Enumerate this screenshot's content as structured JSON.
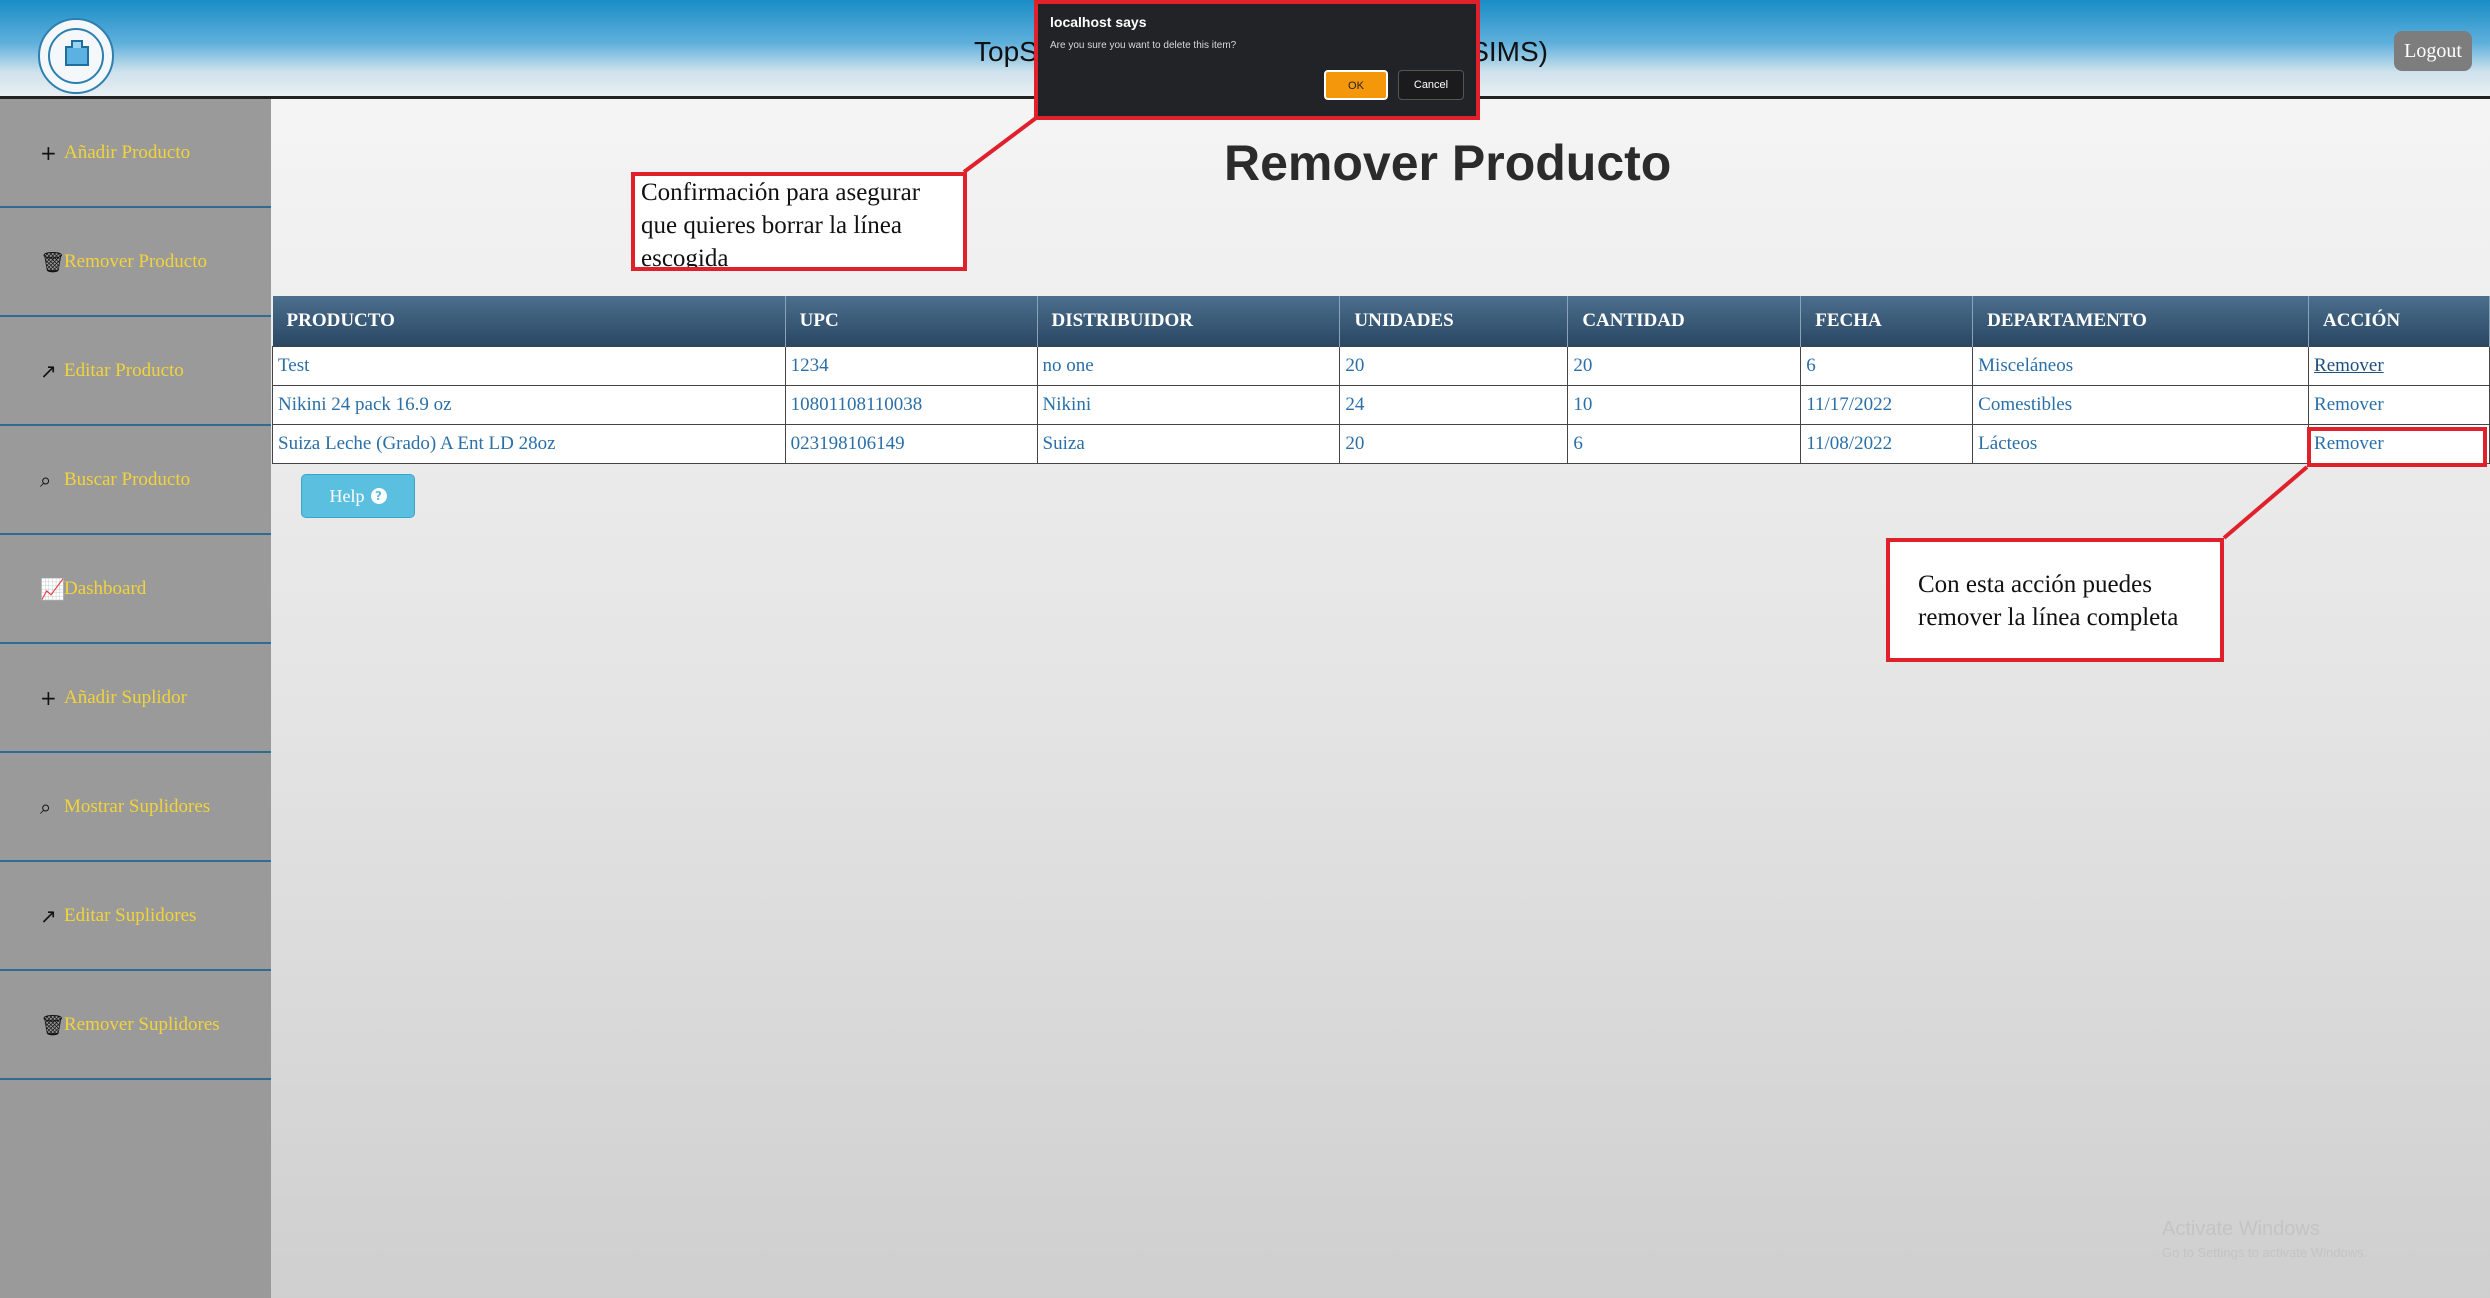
{
  "header": {
    "title_left": "TopS",
    "title_right": "SIMS)",
    "logout_label": "Logout"
  },
  "sidebar": {
    "items": [
      {
        "icon": "plus-icon",
        "glyph": "+",
        "label": "Añadir Producto"
      },
      {
        "icon": "trash-icon",
        "glyph": "🗑",
        "label": "Remover Producto"
      },
      {
        "icon": "trend-up-icon",
        "glyph": "↗",
        "label": "Editar Producto"
      },
      {
        "icon": "search-icon",
        "glyph": "⌕",
        "label": "Buscar Producto"
      },
      {
        "icon": "chart-icon",
        "glyph": "📈",
        "label": "Dashboard"
      },
      {
        "icon": "plus-icon",
        "glyph": "+",
        "label": "Añadir Suplidor"
      },
      {
        "icon": "search-icon",
        "glyph": "⌕",
        "label": "Mostrar Suplidores"
      },
      {
        "icon": "trend-up-icon",
        "glyph": "↗",
        "label": "Editar Suplidores"
      },
      {
        "icon": "trash-icon",
        "glyph": "🗑",
        "label": "Remover Suplidores"
      }
    ]
  },
  "main": {
    "page_title": "Remover Producto",
    "table": {
      "headers": [
        "PRODUCTO",
        "UPC",
        "DISTRIBUIDOR",
        "UNIDADES",
        "CANTIDAD",
        "FECHA",
        "DEPARTAMENTO",
        "ACCIÓN"
      ],
      "rows": [
        [
          "Test",
          "1234",
          "no one",
          "20",
          "20",
          "6",
          "Misceláneos",
          "Remover"
        ],
        [
          "Nikini 24 pack 16.9 oz",
          "10801108110038",
          "Nikini",
          "24",
          "10",
          "11/17/2022",
          "Comestibles",
          "Remover"
        ],
        [
          "Suiza Leche (Grado) A Ent LD 28oz",
          "023198106149",
          "Suiza",
          "20",
          "6",
          "11/08/2022",
          "Lácteos",
          "Remover"
        ]
      ]
    },
    "help_label": "Help"
  },
  "dialog": {
    "title": "localhost says",
    "message": "Are you sure you want to delete this item?",
    "ok_label": "OK",
    "cancel_label": "Cancel"
  },
  "callouts": {
    "confirm_text": "Confirmación para asegurar que quieres borrar la línea escogida",
    "remove_text": "Con esta acción puedes remover la línea completa"
  },
  "watermark": {
    "line1": "Activate Windows",
    "line2": "Go to Settings to activate Windows."
  },
  "colors": {
    "accent_red": "#e0212b",
    "nav_text": "#f2d43a",
    "ok_button": "#f4970b"
  }
}
